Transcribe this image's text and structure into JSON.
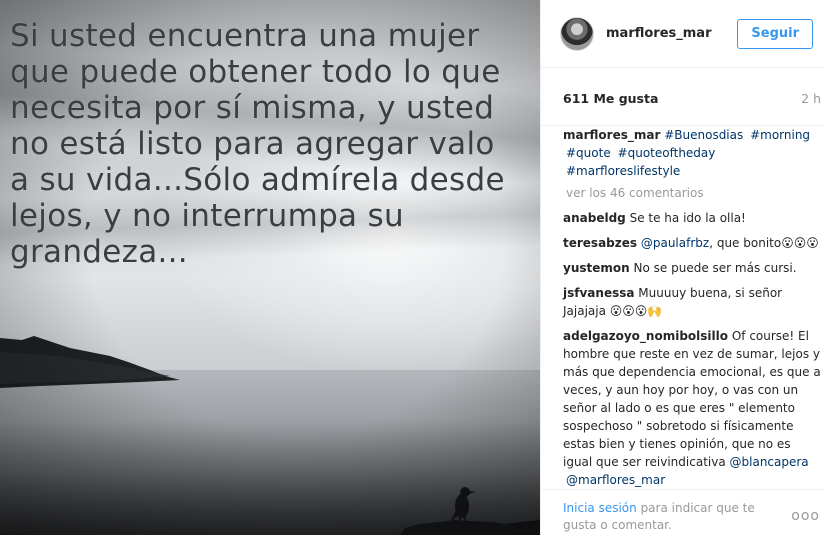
{
  "post": {
    "quote_text": "Si usted encuentra una mujer\nque puede obtener todo lo que\nnecesita por sí misma, y usted\nno está listo para agregar valo\na su vida...Sólo admírela desde\nlejos, y no interrumpa su\ngrandeza..."
  },
  "header": {
    "username": "marflores_mar",
    "follow_label": "Seguir"
  },
  "stats": {
    "likes": "611 Me gusta",
    "time_ago": "2 h"
  },
  "caption": {
    "username": "marflores_mar",
    "hashtags": [
      "#Buenosdias",
      "#morning",
      "#quote",
      "#quoteoftheday",
      "#marfloreslifestyle"
    ]
  },
  "view_more": "ver los 46 comentarios",
  "comments": [
    {
      "username": "anabeldg",
      "text": "Se te ha ido la olla!"
    },
    {
      "username": "teresabzes",
      "mention": "@paulafrbz",
      "text": ", que bonito😮😮😮"
    },
    {
      "username": "yustemon",
      "text": "No se puede ser más cursi."
    },
    {
      "username": "jsfvanessa",
      "text": "Muuuuy buena, si señor Jajajaja 😮😮😮🙌"
    },
    {
      "username": "adelgazoyo_nomibolsillo",
      "text": "Of course! El hombre que reste en vez de sumar, lejos y más que dependencia emocional, es que a veces, y aun hoy por hoy, o vas con un señor al lado o es que eres \" elemento sospechoso \" sobretodo si físicamente estas bien y tienes opinión, que no es igual que ser reivindicativa",
      "mentions": [
        "@blancapera",
        "@marflores_mar"
      ]
    }
  ],
  "footer": {
    "login_link": "Inicia sesión",
    "login_rest": " para indicar que te gusta o comentar.",
    "more_icon": "ellipsis-icon",
    "more_glyph": "ooo"
  },
  "colors": {
    "accent": "#3897f0",
    "hashtag": "#003569",
    "muted": "#999999",
    "text": "#262626"
  }
}
